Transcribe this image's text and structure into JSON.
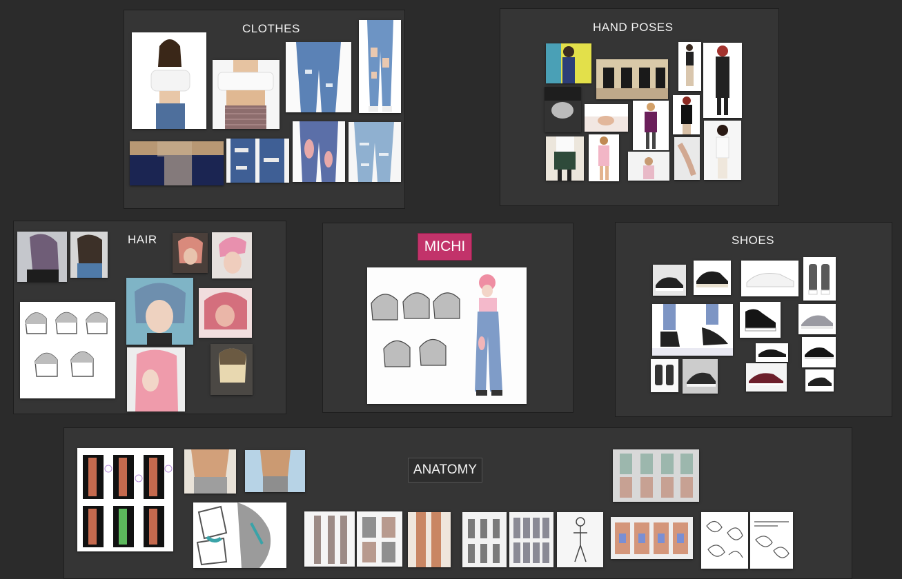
{
  "boards": {
    "clothes": {
      "title": "CLOTHES"
    },
    "hand_poses": {
      "title": "HAND POSES"
    },
    "hair": {
      "title": "HAIR"
    },
    "michi": {
      "title": "MICHI",
      "accent": "#c2336a"
    },
    "shoes": {
      "title": "SHOES"
    },
    "anatomy": {
      "title": "ANATOMY"
    }
  },
  "colors": {
    "canvas": "#2b2b2b",
    "board": "#353535",
    "title_text": "#f2f2f2"
  }
}
